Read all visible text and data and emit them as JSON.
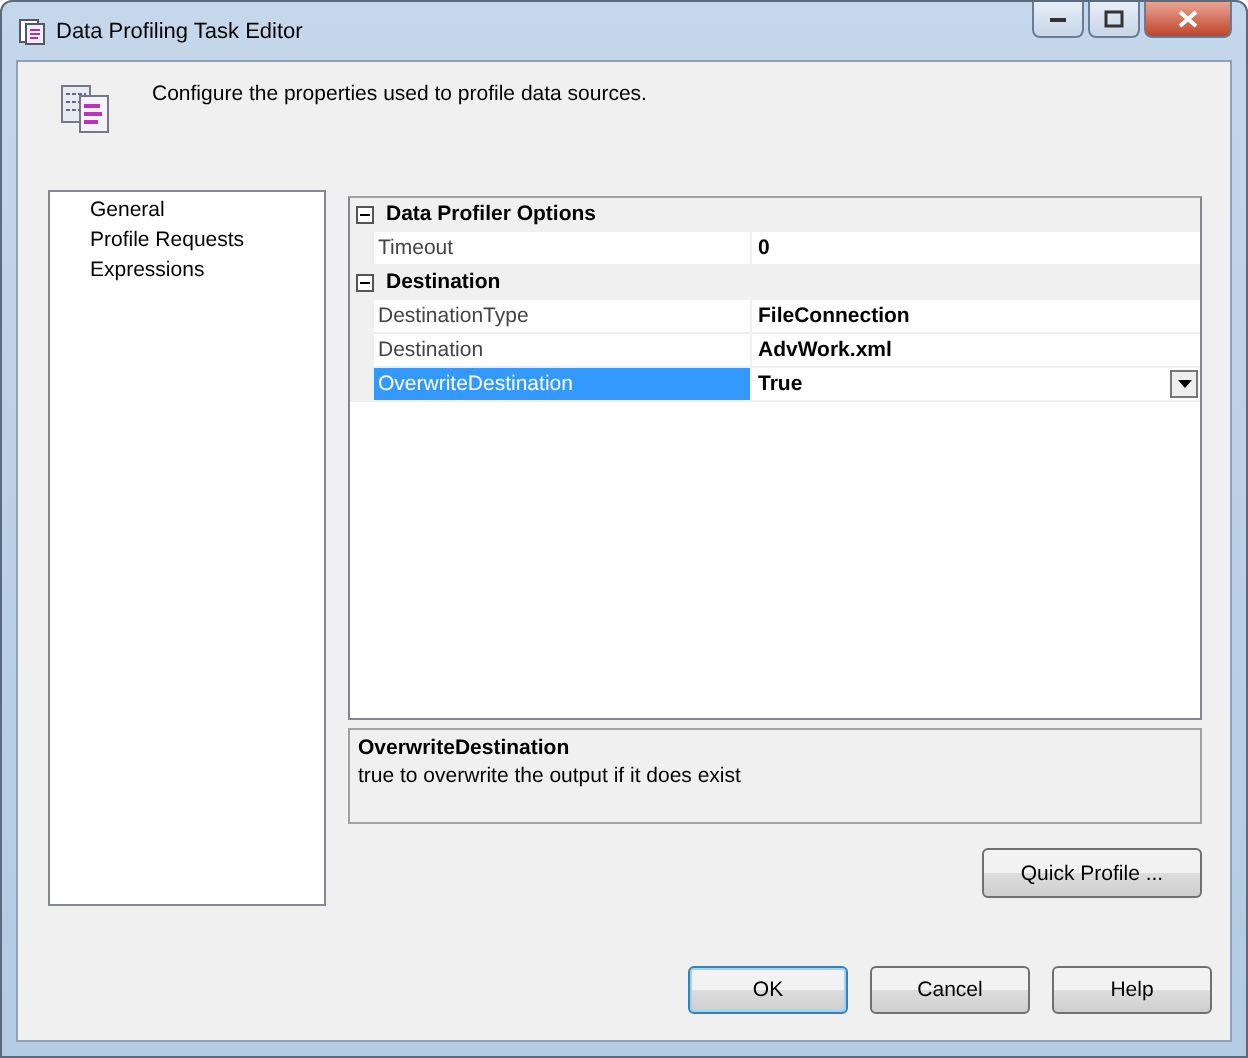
{
  "window": {
    "title": "Data Profiling Task Editor"
  },
  "header": {
    "description": "Configure the properties used to profile data sources."
  },
  "pages": [
    {
      "label": "General"
    },
    {
      "label": "Profile Requests"
    },
    {
      "label": "Expressions"
    }
  ],
  "property_grid": {
    "categories": [
      {
        "name": "Data Profiler Options",
        "expanded": true,
        "properties": [
          {
            "name": "Timeout",
            "value": "0",
            "selected": false
          }
        ]
      },
      {
        "name": "Destination",
        "expanded": true,
        "properties": [
          {
            "name": "DestinationType",
            "value": "FileConnection",
            "selected": false
          },
          {
            "name": "Destination",
            "value": "AdvWork.xml",
            "selected": false
          },
          {
            "name": "OverwriteDestination",
            "value": "True",
            "selected": true
          }
        ]
      }
    ]
  },
  "description_panel": {
    "title": "OverwriteDestination",
    "text": "true to overwrite the output if it does exist"
  },
  "quick_profile_button": "Quick Profile ...",
  "buttons": [
    "OK",
    "Cancel",
    "Help"
  ]
}
